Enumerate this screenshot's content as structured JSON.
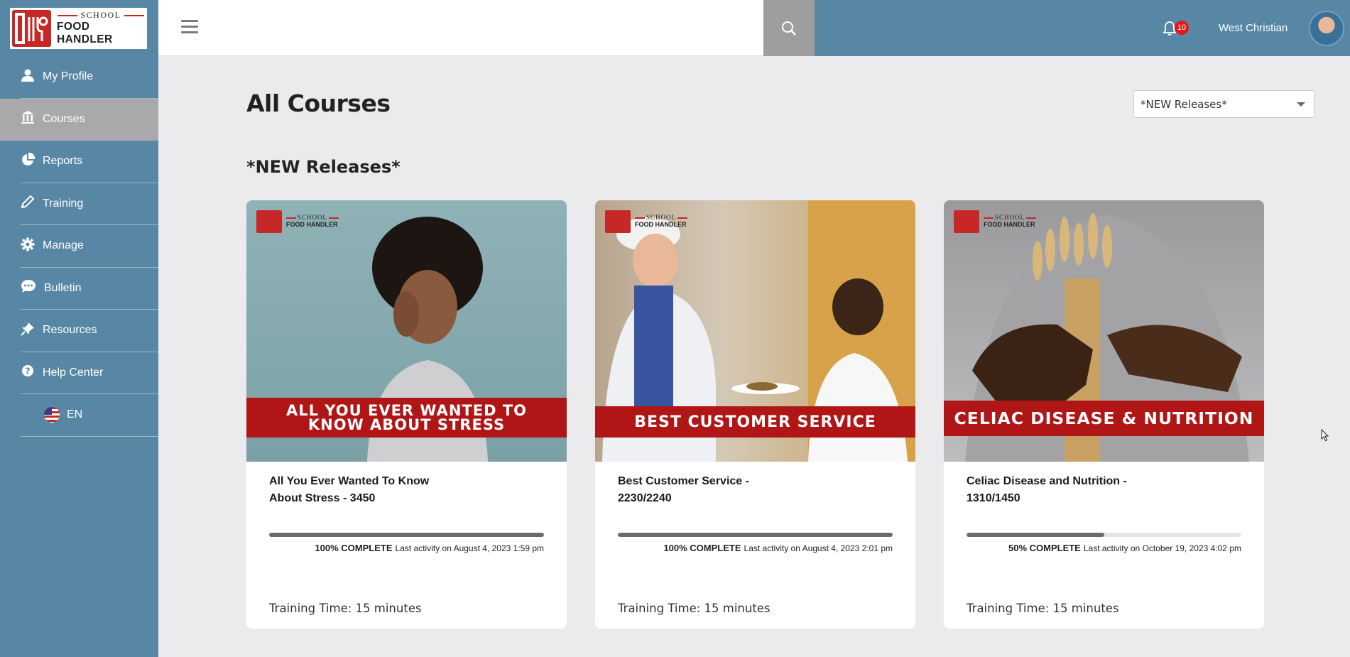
{
  "brand": {
    "logo_small": "SCHOOL",
    "logo_big": "FOOD HANDLER"
  },
  "sidebar": {
    "items": [
      {
        "label": "My Profile",
        "icon": "user-icon"
      },
      {
        "label": "Courses",
        "icon": "bank-icon",
        "active": true
      },
      {
        "label": "Reports",
        "icon": "pie-chart-icon"
      },
      {
        "label": "Training",
        "icon": "pencil-icon"
      },
      {
        "label": "Manage",
        "icon": "gear-icon"
      },
      {
        "label": "Bulletin",
        "icon": "chat-icon"
      },
      {
        "label": "Resources",
        "icon": "pin-icon"
      },
      {
        "label": "Help Center",
        "icon": "help-icon"
      }
    ],
    "language": {
      "label": "EN",
      "icon": "us-flag-icon"
    }
  },
  "header": {
    "notifications_count": "10",
    "user_name": "West Christian"
  },
  "main": {
    "title": "All Courses",
    "filter": {
      "selected": "*NEW Releases*"
    },
    "section_title": "*NEW Releases*",
    "courses": [
      {
        "banner": "ALL YOU EVER WANTED TO KNOW ABOUT STRESS",
        "logo_small": "SCHOOL",
        "logo_big": "FOOD HANDLER",
        "title_line1": "All You Ever Wanted To Know",
        "title_line2": "About Stress - 3450",
        "progress": 1.0,
        "complete_label": "100% COMPLETE",
        "last_activity": "Last activity on August 4, 2023 1:59 pm",
        "training_time": "Training Time: 15 minutes"
      },
      {
        "banner": "BEST CUSTOMER SERVICE",
        "logo_small": "SCHOOL",
        "logo_big": "FOOD HANDLER",
        "title_line1": "Best Customer Service -",
        "title_line2": "2230/2240",
        "progress": 1.0,
        "complete_label": "100% COMPLETE",
        "last_activity": "Last activity on August 4, 2023 2:01 pm",
        "training_time": "Training Time: 15 minutes"
      },
      {
        "banner": "CELIAC DISEASE & NUTRITION",
        "logo_small": "SCHOOL",
        "logo_big": "FOOD HANDLER",
        "title_line1": "Celiac Disease and Nutrition -",
        "title_line2": "1310/1450",
        "progress": 0.5,
        "complete_label": "50% COMPLETE",
        "last_activity": "Last activity on October 19, 2023 4:02 pm",
        "training_time": "Training Time: 15 minutes"
      }
    ]
  },
  "colors": {
    "sidebar_bg": "#5887a6",
    "active_item": "#a9a9ab",
    "brand_red": "#c62828",
    "banner_red": "#b01616",
    "badge_red": "#e01b1b"
  }
}
